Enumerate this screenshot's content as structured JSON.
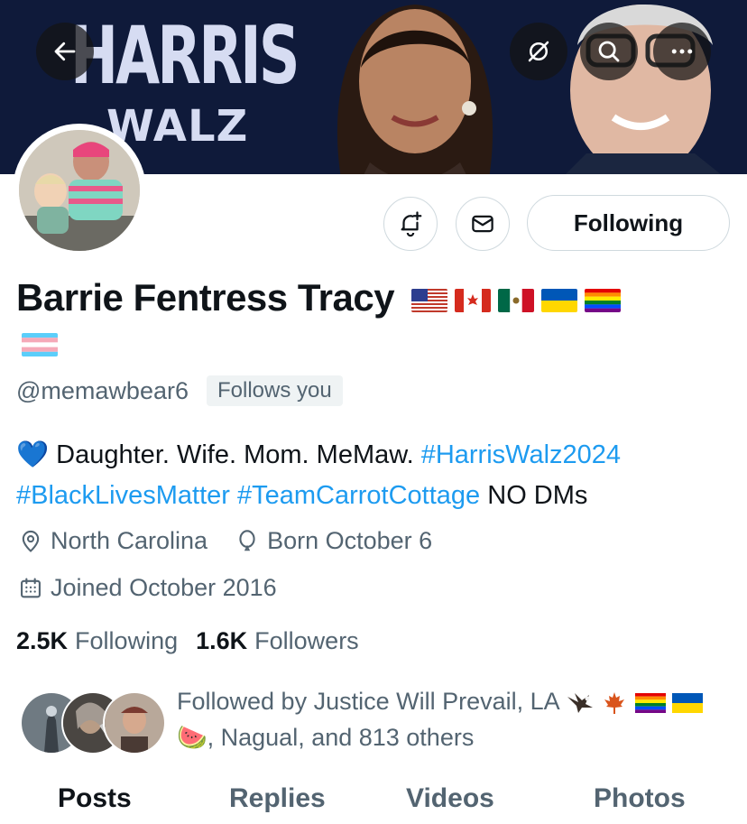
{
  "banner": {
    "title": "HARRIS",
    "subtitle": "WALZ",
    "background_color": "#0f1a3a"
  },
  "top_actions": {
    "back_icon": "arrow-left-icon",
    "grok_icon": "slash-circle-icon",
    "search_icon": "search-icon",
    "more_icon": "more-horizontal-icon"
  },
  "profile_actions": {
    "notify_icon": "bell-plus-icon",
    "message_icon": "envelope-icon",
    "following_label": "Following"
  },
  "profile": {
    "display_name": "Barrie Fentress Tracy",
    "flags": [
      "us-flag",
      "canada-flag",
      "mexico-flag",
      "ukraine-flag",
      "rainbow-flag",
      "transgender-flag"
    ],
    "handle": "@memawbear6",
    "follows_you": "Follows you",
    "bio_heart": "💙",
    "bio_text": "Daughter. Wife. Mom. MeMaw.",
    "bio_tags_line1": "#HarrisWalz2024",
    "bio_tag_blm": "#BlackLivesMatter",
    "bio_tag_carrot": "#TeamCarrotCottage",
    "bio_tail": "NO DMs",
    "location": "North Carolina",
    "birthday": "Born October 6",
    "joined": "Joined October 2016"
  },
  "stats": {
    "following_count": "2.5K",
    "following_label": "Following",
    "followers_count": "1.6K",
    "followers_label": "Followers"
  },
  "followed_by": {
    "line1": "Followed by Justice Will Prevail, LA",
    "line2": ", Nagual, and 813 others",
    "emoji_watermelon": "🍉"
  },
  "tabs": [
    "Posts",
    "Replies",
    "Videos",
    "Photos"
  ],
  "colors": {
    "link": "#1d9bf0",
    "secondary_text": "#536471",
    "primary_text": "#0f1419"
  }
}
